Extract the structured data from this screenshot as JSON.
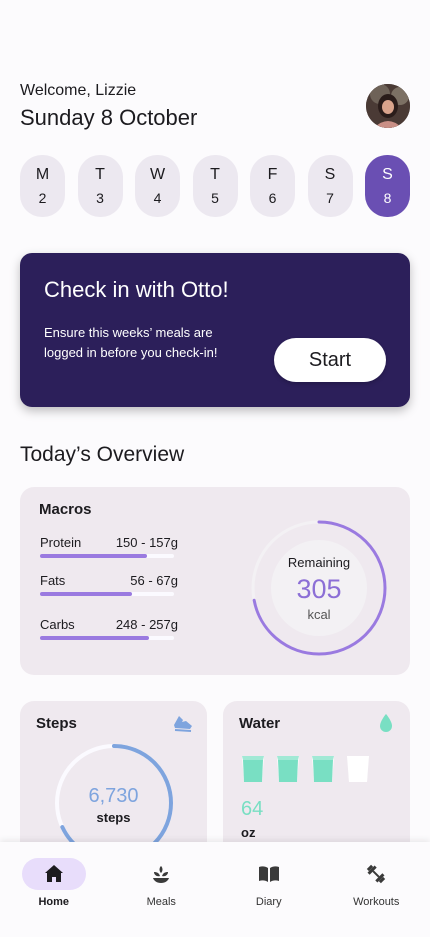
{
  "header": {
    "welcome": "Welcome, Lizzie",
    "date": "Sunday 8 October"
  },
  "days": [
    {
      "letter": "M",
      "num": "2"
    },
    {
      "letter": "T",
      "num": "3"
    },
    {
      "letter": "W",
      "num": "4"
    },
    {
      "letter": "T",
      "num": "5"
    },
    {
      "letter": "F",
      "num": "6"
    },
    {
      "letter": "S",
      "num": "7"
    },
    {
      "letter": "S",
      "num": "8"
    }
  ],
  "checkin": {
    "title": "Check in with Otto!",
    "description": "Ensure this weeks’ meals are logged in before you check-in!",
    "button": "Start"
  },
  "overview": {
    "title": "Today’s Overview",
    "macros": {
      "title": "Macros",
      "items": [
        {
          "name": "Protein",
          "range": "150 - 157g",
          "progress": 0.8
        },
        {
          "name": "Fats",
          "range": "56 - 67g",
          "progress": 0.69
        },
        {
          "name": "Carbs",
          "range": "248 - 257g",
          "progress": 0.81
        }
      ],
      "remaining_label": "Remaining",
      "remaining_value": "305",
      "remaining_unit": "kcal",
      "ring_progress": 0.72
    },
    "steps": {
      "title": "Steps",
      "value": "6,730",
      "unit": "steps",
      "icon": "shoe-icon",
      "progress": 0.68
    },
    "water": {
      "title": "Water",
      "value": "64",
      "unit": "oz",
      "icon": "water-drop-icon",
      "glasses_filled": 3,
      "glasses_total": 4
    }
  },
  "colors": {
    "accent": "#6a4fb3",
    "checkin_bg": "#2c1f5a",
    "water": "#79dfc3",
    "steps": "#7ea4de",
    "macro_bar": "#9a7ae0"
  },
  "nav": [
    {
      "label": "Home",
      "icon": "home-icon",
      "active": true
    },
    {
      "label": "Meals",
      "icon": "meals-icon",
      "active": false
    },
    {
      "label": "Diary",
      "icon": "book-icon",
      "active": false
    },
    {
      "label": "Workouts",
      "icon": "dumbbell-icon",
      "active": false
    }
  ]
}
